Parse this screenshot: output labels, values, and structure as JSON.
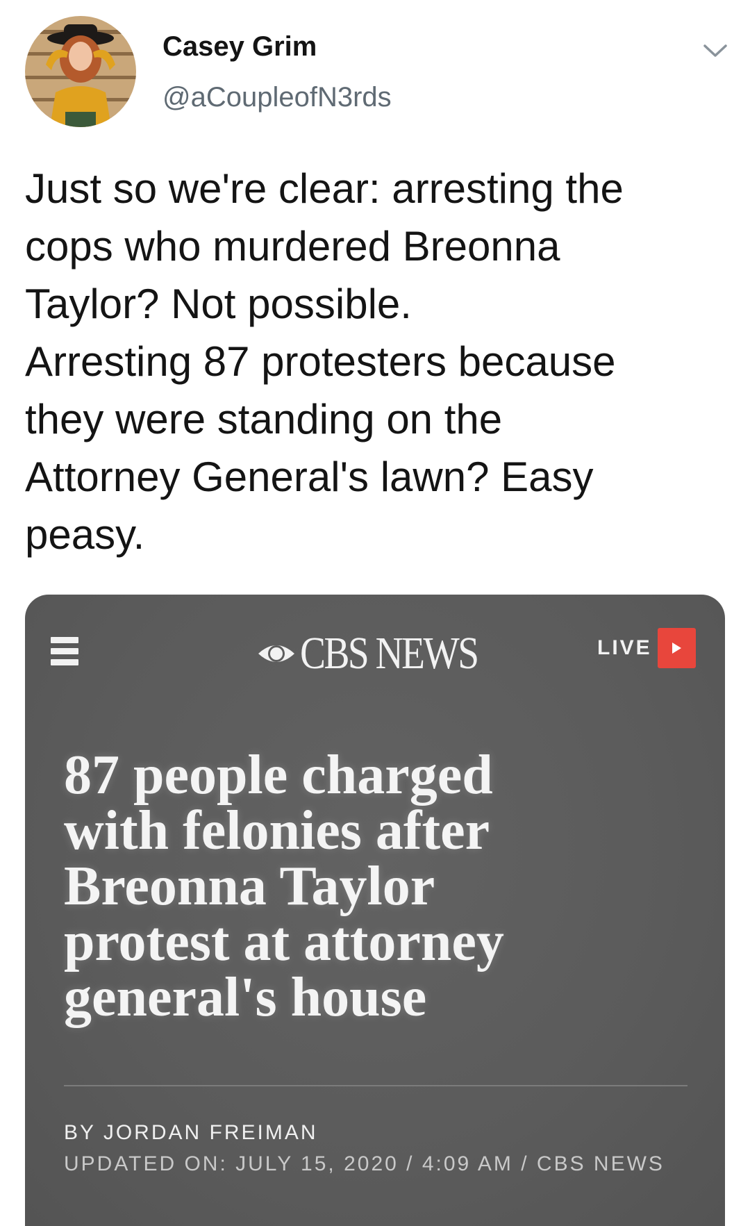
{
  "author": {
    "display_name": "Casey Grim",
    "handle": "@aCoupleofN3rds"
  },
  "tweet": {
    "lines": [
      "Just so we're clear: arresting the",
      "cops who murdered Breonna",
      "Taylor? Not possible.",
      "Arresting 87 protesters because",
      "they were standing on the",
      "Attorney General's lawn? Easy",
      "peasy."
    ]
  },
  "card": {
    "brand": "CBS NEWS",
    "live_label": "LIVE",
    "live_color": "#e8463c",
    "headline_lines": [
      "87 people charged",
      "with felonies after",
      "Breonna Taylor",
      "protest at attorney",
      "general's house"
    ],
    "byline": "BY JORDAN FREIMAN",
    "updated": "UPDATED ON: JULY 15, 2020 / 4:09 AM / CBS NEWS"
  },
  "icons": {
    "menu": "hamburger-menu-icon",
    "caret": "chevron-down-icon",
    "brand_logo": "cbs-eye-icon",
    "live": "play-icon"
  }
}
